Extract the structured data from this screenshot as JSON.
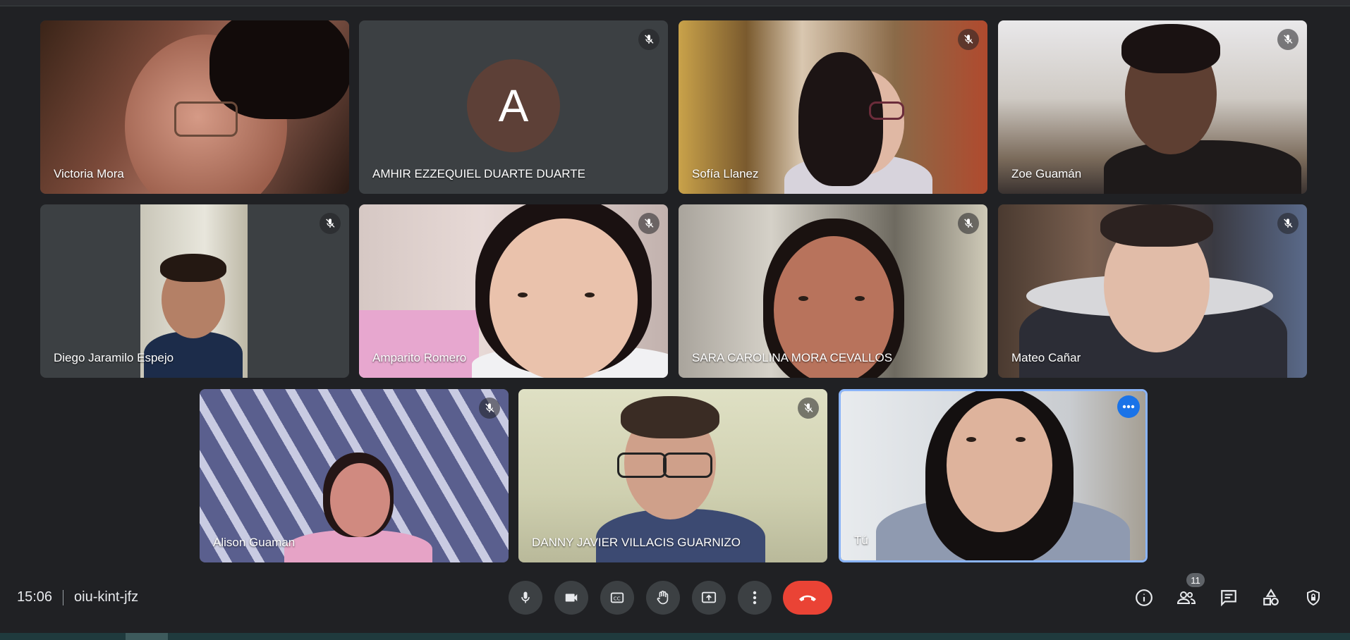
{
  "meeting": {
    "time": "15:06",
    "code": "oiu-kint-jfz",
    "participant_count": "11"
  },
  "participants": [
    {
      "name": "Victoria Mora",
      "muted": false
    },
    {
      "name": "AMHIR EZZEQUIEL DUARTE DUARTE",
      "muted": true,
      "avatar_letter": "A"
    },
    {
      "name": "Sofía Llanez",
      "muted": true
    },
    {
      "name": "Zoe Guamán",
      "muted": true
    },
    {
      "name": "Diego Jaramilo Espejo",
      "muted": true
    },
    {
      "name": "Amparito Romero",
      "muted": true
    },
    {
      "name": "SARA CAROLINA MORA CEVALLOS",
      "muted": true
    },
    {
      "name": "Mateo Cañar",
      "muted": true
    },
    {
      "name": "Alison Guaman",
      "muted": true
    },
    {
      "name": "DANNY JAVIER VILLACIS GUARNIZO",
      "muted": true
    },
    {
      "name": "Tú",
      "muted": false,
      "self": true
    }
  ],
  "controls": {
    "center": [
      "microphone-icon",
      "camera-icon",
      "captions-icon",
      "raise-hand-icon",
      "present-screen-icon",
      "more-options-icon",
      "end-call-icon"
    ],
    "right": [
      "info-icon",
      "people-icon",
      "chat-icon",
      "activities-icon",
      "host-controls-icon"
    ]
  },
  "colors": {
    "background": "#202124",
    "tile": "#3c4043",
    "end_call": "#ea4335",
    "self_border": "#8ab4f8",
    "accent": "#1a73e8",
    "avatar": "#5d4037"
  }
}
